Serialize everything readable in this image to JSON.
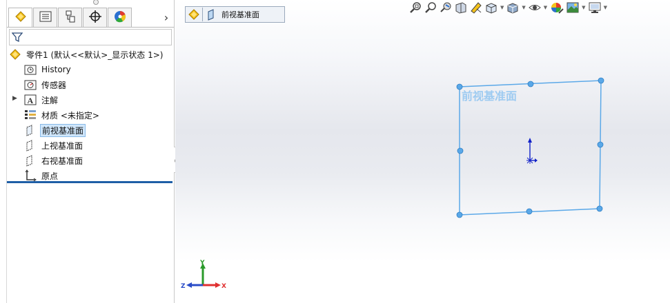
{
  "sidebar": {
    "tabs": [
      {
        "name": "featuremanager-tab",
        "icon": "feature-manager-icon"
      },
      {
        "name": "propertymanager-tab",
        "icon": "property-manager-icon"
      },
      {
        "name": "configurationmanager-tab",
        "icon": "configuration-manager-icon"
      },
      {
        "name": "dimxpert-tab",
        "icon": "dimxpert-icon"
      },
      {
        "name": "display-manager-tab",
        "icon": "display-manager-icon"
      }
    ],
    "more_tabs_glyph": "›",
    "tree": {
      "root_label": "零件1  (默认<<默认>_显示状态 1>)",
      "items": [
        {
          "label": "History",
          "icon": "history-folder-icon"
        },
        {
          "label": "传感器",
          "icon": "sensors-folder-icon"
        },
        {
          "label": "注解",
          "icon": "annotations-icon"
        },
        {
          "label": "材质 <未指定>",
          "icon": "material-icon"
        },
        {
          "label": "前视基准面",
          "icon": "plane-icon",
          "selected": true
        },
        {
          "label": "上视基准面",
          "icon": "plane-icon"
        },
        {
          "label": "右视基准面",
          "icon": "plane-icon"
        },
        {
          "label": "原点",
          "icon": "origin-icon"
        }
      ]
    }
  },
  "viewport": {
    "breadcrumb": {
      "label": "前视基准面"
    },
    "plane_label": "前视基准面",
    "triad": {
      "x": "X",
      "y": "Y",
      "z": "Z"
    },
    "hud_buttons": [
      "zoom-to-fit-icon",
      "zoom-to-area-icon",
      "previous-view-icon",
      "section-view-icon",
      "dynamic-annotation-icon",
      "view-orientation-icon",
      "display-style-icon",
      "hide-show-items-icon",
      "edit-appearance-icon",
      "apply-scene-icon",
      "view-settings-icon"
    ]
  },
  "colors": {
    "plane": "#5aa8e8",
    "plane_label": "#9ecbf1",
    "selection": "#cfe6fb",
    "accent_bar": "#1e5ea6",
    "axis_x": "#e03030",
    "axis_y": "#2a9a2a",
    "axis_z": "#2a4cc8"
  }
}
